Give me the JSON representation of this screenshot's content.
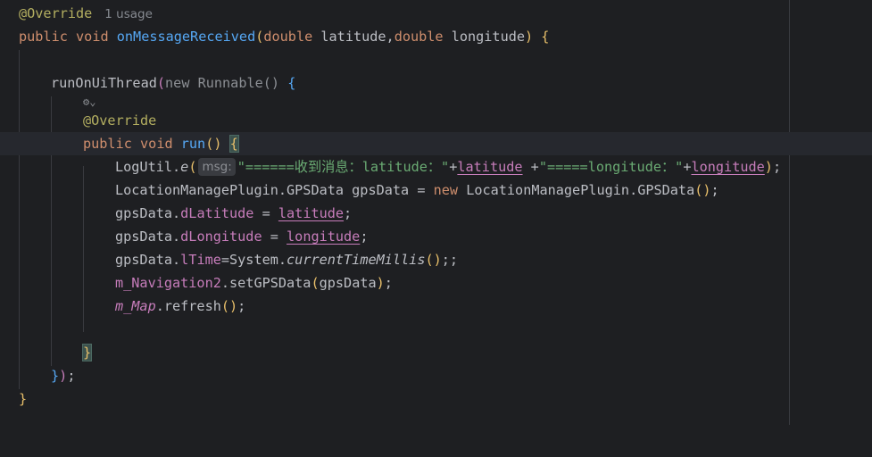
{
  "editor": {
    "usage_hint": "1 usage",
    "lines": {
      "l1_annotation": "@Override",
      "l2_public": "public",
      "l2_void": "void",
      "l2_method": "onMessageReceived",
      "l2_open": "(",
      "l2_double1": "double",
      "l2_param1": " latitude,",
      "l2_double2": "double",
      "l2_param2": " longitude",
      "l2_close": ")",
      "l2_brace": " {",
      "l4_call": "runOnUiThread",
      "l4_open": "(",
      "l4_new": "new",
      "l4_runnable": " Runnable()",
      "l4_brace": " {",
      "l5_icon": "⚙⌄",
      "l6_annotation": "@Override",
      "l7_public": "public",
      "l7_void": "void",
      "l7_run": "run",
      "l7_parens": "()",
      "l7_brace": "{",
      "l8_logutil": "LogUtil.",
      "l8_e": "e",
      "l8_open": "(",
      "l8_hint": "msg:",
      "l8_str1": "\"======收到消息：latitude：\"",
      "l8_plus1": "+",
      "l8_lat": "latitude",
      "l8_plus2": " +",
      "l8_str2": "\"=====longitude：\"",
      "l8_plus3": "+",
      "l8_lon": "longitude",
      "l8_close": ")",
      "l8_semi": ";",
      "l9_text1": "LocationManagePlugin.GPSData gpsData = ",
      "l9_new": "new",
      "l9_text2": " LocationManagePlugin.GPSData",
      "l9_parens": "()",
      "l9_semi": ";",
      "l10_obj": "gpsData.",
      "l10_field": "dLatitude",
      "l10_eq": " = ",
      "l10_val": "latitude",
      "l10_semi": ";",
      "l11_obj": "gpsData.",
      "l11_field": "dLongitude",
      "l11_eq": " = ",
      "l11_val": "longitude",
      "l11_semi": ";",
      "l12_obj": "gpsData.",
      "l12_field": "lTime",
      "l12_eq": "=System.",
      "l12_method": "currentTimeMillis",
      "l12_parens": "()",
      "l12_semi": ";;",
      "l13_field": "m_Navigation2",
      "l13_text": ".setGPSData",
      "l13_open": "(",
      "l13_arg": "gpsData",
      "l13_close": ")",
      "l13_semi": ";",
      "l14_field": "m_Map",
      "l14_text": ".refresh",
      "l14_parens": "()",
      "l14_semi": ";",
      "l16_brace": "}",
      "l17_brace": "}",
      "l17_paren": ")",
      "l17_semi": ";",
      "l18_brace": "}"
    }
  }
}
